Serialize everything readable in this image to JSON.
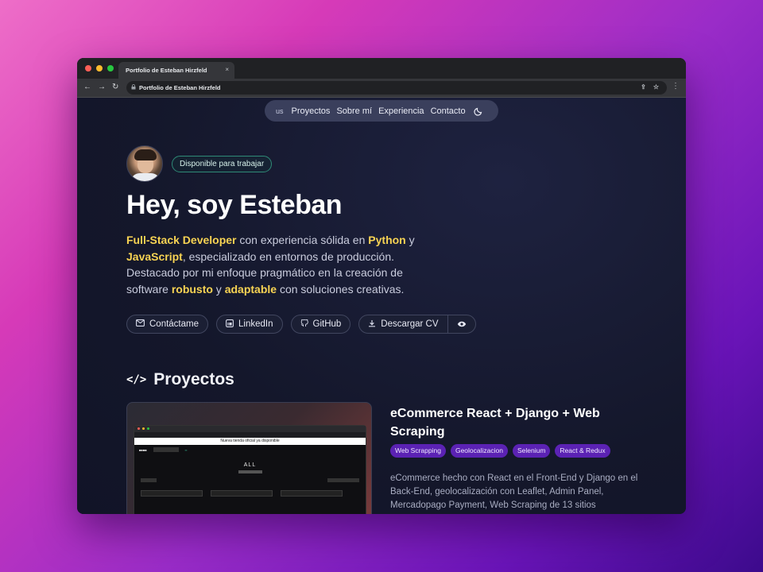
{
  "browser": {
    "tab_title": "Portfolio de Esteban Hirzfeld",
    "tab_close": "×",
    "url": "Portfolio de Esteban Hirzfeld",
    "nav": {
      "back": "←",
      "forward": "→",
      "reload": "↻"
    },
    "url_icons": [
      "share-icon",
      "star-icon"
    ],
    "menu": "⋮",
    "traffic_colors": [
      "#ff5f57",
      "#febc2e",
      "#28c840"
    ]
  },
  "navbar": {
    "lang": "us",
    "items": [
      "Proyectos",
      "Sobre mí",
      "Experiencia",
      "Contacto"
    ],
    "theme_icon": "moon-icon"
  },
  "hero": {
    "badge": "Disponible para trabajar",
    "title": "Hey, soy Esteban",
    "desc": [
      {
        "t": "Full-Stack Developer",
        "hl": true
      },
      {
        "t": " con experiencia sólida en ",
        "hl": false
      },
      {
        "t": "Python",
        "hl": true
      },
      {
        "t": " y ",
        "hl": false
      },
      {
        "t": "JavaScript",
        "hl": true
      },
      {
        "t": ", especializado en entornos de producción. Destacado por mi enfoque pragmático en la creación de software ",
        "hl": false
      },
      {
        "t": "robusto",
        "hl": true
      },
      {
        "t": " y ",
        "hl": false
      },
      {
        "t": "adaptable",
        "hl": true
      },
      {
        "t": " con soluciones creativas.",
        "hl": false
      }
    ],
    "highlight_color": "#f7d353",
    "buttons": {
      "contact": "Contáctame",
      "linkedin": "LinkedIn",
      "github": "GitHub",
      "cv": "Descargar CV"
    }
  },
  "projects": {
    "section_title": "Proyectos",
    "items": [
      {
        "title": "eCommerce React + Django + Web Scraping",
        "tags": [
          "Web Scrapping",
          "Geolocalizacion",
          "Selenium",
          "React & Redux"
        ],
        "desc": "eCommerce hecho con React en el Front-End y Django en el Back-End, geolocalización con Leaflet, Admin Panel, Mercadopago Payment, Web Scraping de 13 sitios",
        "screenshot": {
          "banner": "Nueva tienda oficial ya disponible",
          "heading": "ALL"
        }
      }
    ]
  },
  "colors": {
    "accent_tag": "#5b22b4",
    "badge_border": "#2f8a77"
  }
}
